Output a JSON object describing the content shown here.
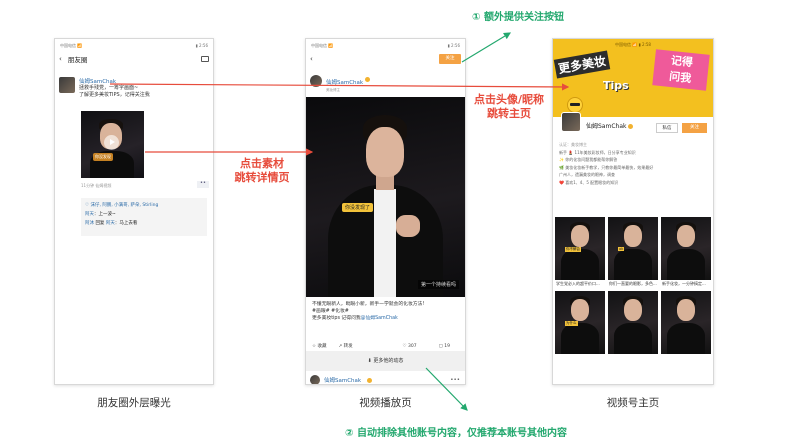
{
  "colors": {
    "accent_red": "#e74c3c",
    "accent_green": "#23a86e",
    "follow_orange": "#f4a244",
    "banner_yellow": "#f3c01f",
    "link_blue": "#2b6ba8"
  },
  "p1": {
    "status_left": "中国电信 📶",
    "status_right": "▮ 2:56",
    "title": "朋友圈",
    "post": {
      "name": "仙姆SamChak",
      "text_line1": "拯救手残党，一筹字画面~",
      "text_line2": "了解更多美妆TIPS，记得关注我",
      "video_caption": "你没发现",
      "meta": "11分钟  仙姆视频"
    },
    "comments": {
      "likes": "♡ 沫仔, 阿鹏, 小满哥, 萨朵, Stirling",
      "c1_name": "阿天",
      "c1_text": "：上一波~",
      "c2_name": "阿沐",
      "c2_reply": "回复",
      "c2_to": "阿天",
      "c2_text": "：马上去看"
    },
    "caption": "朋友圈外层曝光"
  },
  "p2": {
    "status_left": "中国电信 📶",
    "status_right": "▮ 2:56",
    "follow_btn": "关注",
    "author_name": "仙姆SamChak",
    "author_sub": "美妆博主",
    "player_cap1": "你没发现了",
    "player_cap2": "第一个持续看吗",
    "desc_line1": "不懂无眼新人，毗眼小新，新手一学就会的化妆方法!",
    "desc_line2": "#画眼# #化妆#",
    "desc_line3_pre": "更多美妆tips 记得问我",
    "desc_line3_hl": "@仙姆SamChak",
    "actions": {
      "fav": "☆ 收藏",
      "share": "↗ 转发",
      "likes": "♡ 307",
      "comments": "▢ 19"
    },
    "more_btn": "⬇ 更多他的动态",
    "next_name": "仙姆SamChak",
    "next_more": "•••",
    "caption": "视频播放页"
  },
  "p3": {
    "status_left": "中国电信 📶  ▮ 2:58",
    "banner_t1": "更多美妆",
    "banner_t2": "Tips",
    "banner_t3_line1": "记得",
    "banner_t3_line2": "问我",
    "profile_name": "仙姆SamChak",
    "dm_btn": "私信",
    "follow_btn": "关注",
    "bio_line1": "认证：美妆博主",
    "bio_line2": "新手 💄 11年美妆彩妆师，日分享专业知识",
    "bio_line3": "✨ 你的化妆问题我都能帮你解答",
    "bio_line4": "🌿 美妆化妆新手教学，只教你最简单最快，效果最好",
    "bio_line5": "广州人，遗漏美妆的眼神，调查",
    "bio_line6": "❤️ 喜欢1、4、5 配置眼妆的知识",
    "grid": [
      {
        "tag": "你不解会",
        "title": "学生党必入的超平价口..."
      },
      {
        "tag": "ok",
        "title": "你们一直要的眼影，多色..."
      },
      {
        "tag": "",
        "title": "新手化妆，一分钟搞定..."
      },
      {
        "tag": "为什么",
        "title": "画眼的不要这样..."
      },
      {
        "tag": "",
        "title": "底妆卡粉的原因..."
      },
      {
        "tag": "",
        "title": "日常通勤妆教程..."
      }
    ],
    "caption": "视频号主页"
  },
  "annotations": {
    "a1_line1": "点击素材",
    "a1_line2": "跳转详情页",
    "a2_line1": "点击头像/昵称",
    "a2_line2": "跳转主页",
    "top_note": "① 额外提供关注按钮",
    "bottom_note": "② 自动排除其他账号内容，仅推荐本账号其他内容"
  }
}
